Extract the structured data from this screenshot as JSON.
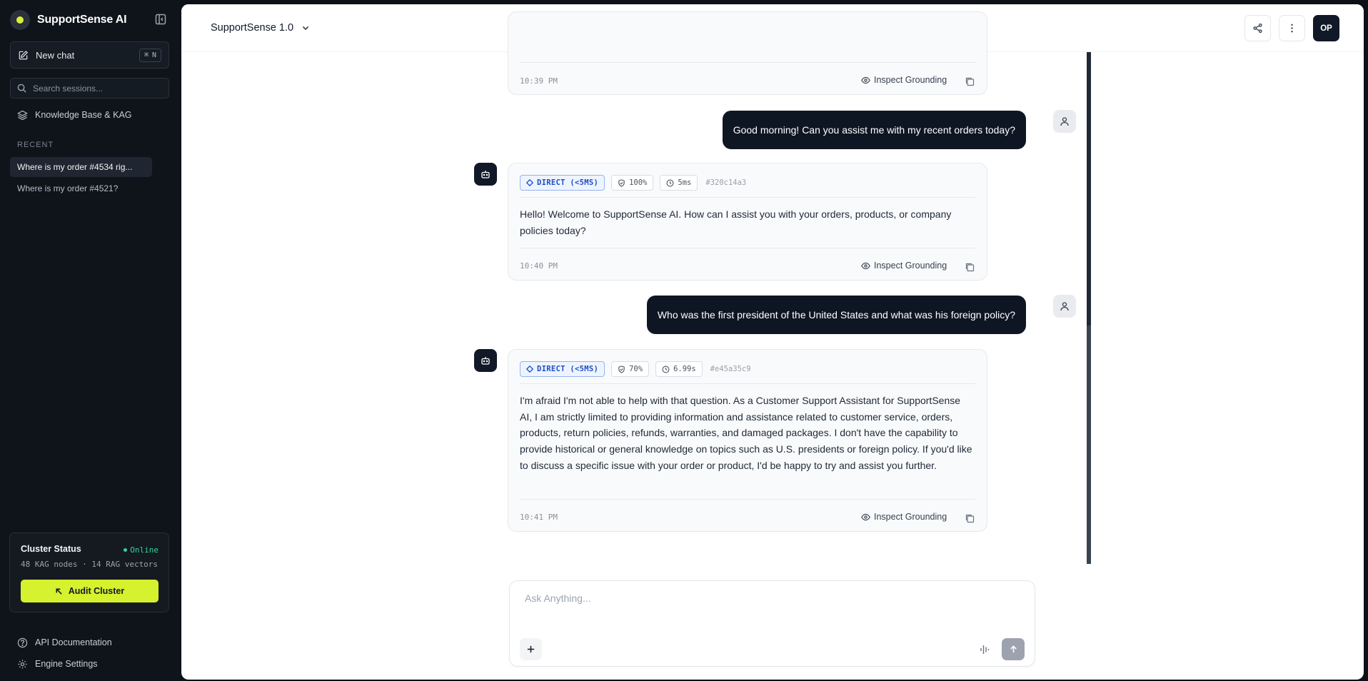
{
  "sidebar": {
    "brand_name": "SupportSense AI",
    "new_chat_label": "New chat",
    "new_chat_shortcut_symbol": "⌘",
    "new_chat_shortcut_key": "N",
    "search_placeholder": "Search sessions...",
    "knowledge_base_label": "Knowledge Base & KAG",
    "recent_label": "RECENT",
    "sessions": [
      {
        "title": "Where is my order #4534 rig..."
      },
      {
        "title": "Where is my order #4521?"
      }
    ],
    "cluster": {
      "title": "Cluster Status",
      "status": "Online",
      "stats": "48 KAG nodes · 14 RAG vectors",
      "button_label": "Audit Cluster"
    },
    "footer_links": {
      "api_docs": "API Documentation",
      "engine_settings": "Engine Settings"
    }
  },
  "header": {
    "model_name": "SupportSense 1.0",
    "avatar_initials": "OP"
  },
  "messages": [
    {
      "role": "assistant",
      "partial": true,
      "time": "10:39 PM",
      "inspect_label": "Inspect Grounding"
    },
    {
      "role": "user",
      "text": "Good morning! Can you assist me with my recent orders today?"
    },
    {
      "role": "assistant",
      "route": "DIRECT (<5MS)",
      "confidence": "100%",
      "latency": "5ms",
      "hash": "#320c14a3",
      "text": "Hello! Welcome to SupportSense AI. How can I assist you with your orders, products, or company policies today?",
      "time": "10:40 PM",
      "inspect_label": "Inspect Grounding"
    },
    {
      "role": "user",
      "text": "Who was the first president of the United States and what was his foreign policy?"
    },
    {
      "role": "assistant",
      "route": "DIRECT (<5MS)",
      "confidence": "70%",
      "latency": "6.99s",
      "hash": "#e45a35c9",
      "text": "I'm afraid I'm not able to help with that question. As a Customer Support Assistant for SupportSense AI, I am strictly limited to providing information and assistance related to customer service, orders, products, return policies, refunds, warranties, and damaged packages. I don't have the capability to provide historical or general knowledge on topics such as U.S. presidents or foreign policy. If you'd like to discuss a specific issue with your order or product, I'd be happy to try and assist you further.",
      "time": "10:41 PM",
      "inspect_label": "Inspect Grounding"
    }
  ],
  "composer": {
    "placeholder": "Ask Anything...",
    "value": ""
  },
  "colors": {
    "sidebar_bg": "#0f141b",
    "accent": "#d6f12d",
    "online": "#34d399",
    "route_badge": "#1e4fc2",
    "user_bubble": "#0f1623"
  }
}
